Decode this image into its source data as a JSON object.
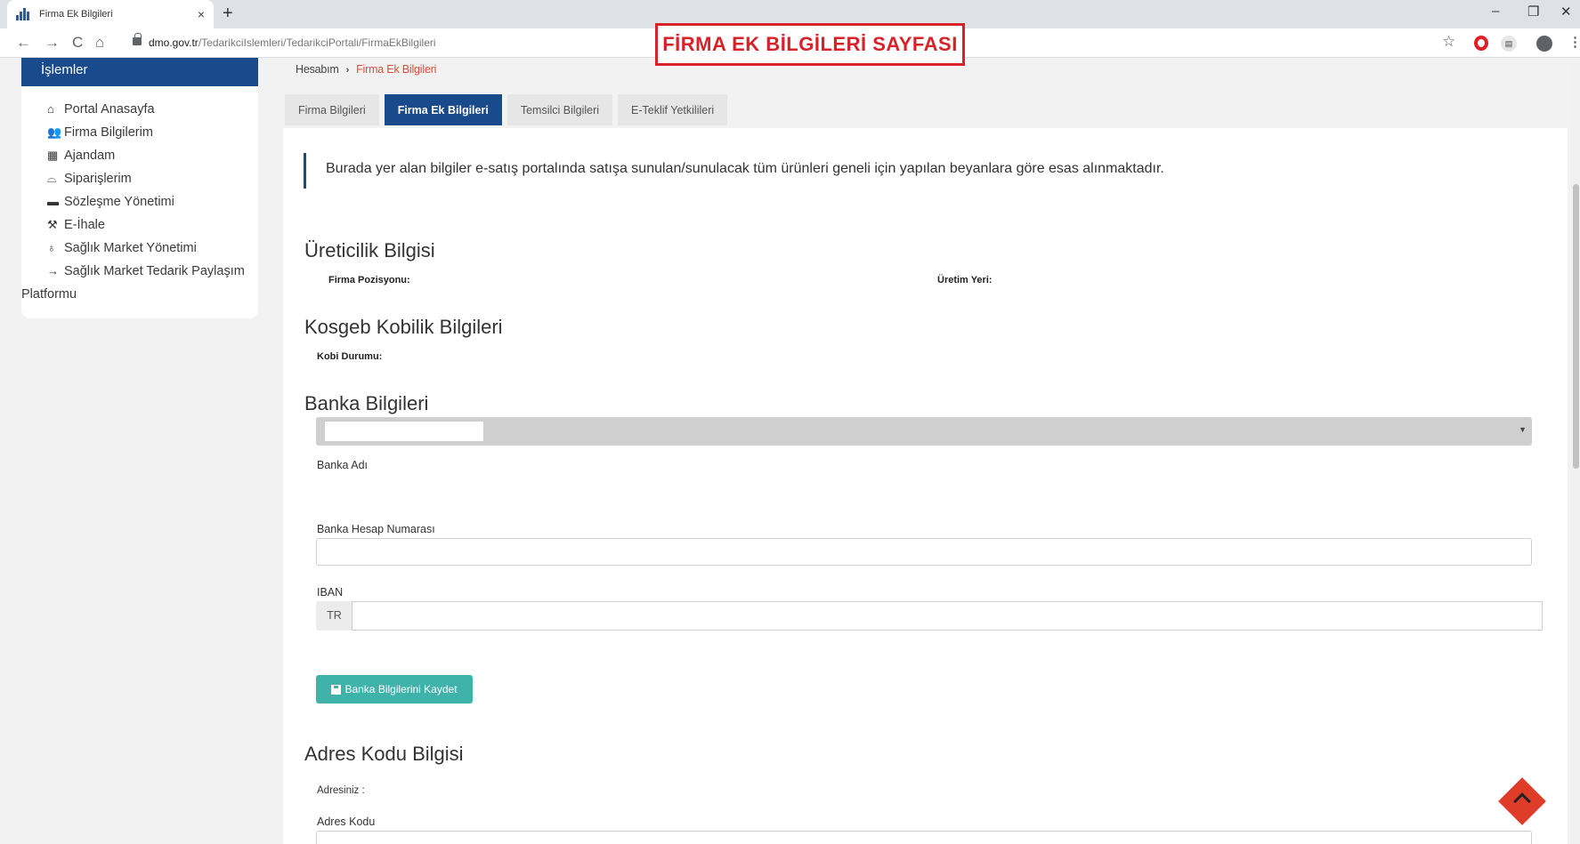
{
  "browser": {
    "tab_title": "Firma Ek Bilgileri",
    "close_glyph": "×",
    "newtab_glyph": "+",
    "minimize_glyph": "–",
    "restore_glyph": "❐",
    "winclose_glyph": "✕",
    "back_glyph": "←",
    "forward_glyph": "→",
    "reload_glyph": "C",
    "home_glyph": "⌂",
    "url_domain": "dmo.gov.tr",
    "url_path": "/TedarikciIslemleri/TedarikciPortali/FirmaEkBilgileri",
    "star_glyph": "☆",
    "menu_glyph": "⋮"
  },
  "annotation": "FİRMA EK BİLGİLERİ SAYFASI",
  "sidebar": {
    "title": "İşlemler",
    "items": [
      {
        "icon": "home-icon",
        "glyph": "⌂",
        "label": "Portal Anasayfa"
      },
      {
        "icon": "users-icon",
        "glyph": "👥",
        "label": "Firma Bilgilerim"
      },
      {
        "icon": "calendar-icon",
        "glyph": "▦",
        "label": "Ajandam"
      },
      {
        "icon": "basket-icon",
        "glyph": "⌓",
        "label": "Siparişlerim"
      },
      {
        "icon": "briefcase-icon",
        "glyph": "▬",
        "label": "Sözleşme Yönetimi"
      },
      {
        "icon": "gavel-icon",
        "glyph": "⚒",
        "label": "E-İhale"
      },
      {
        "icon": "stethoscope-icon",
        "glyph": "♁",
        "label": "Sağlık Market Yönetimi"
      },
      {
        "icon": "arrow-right-icon",
        "glyph": "→",
        "label": "Sağlık Market Tedarik Paylaşım",
        "label2": "Platformu"
      }
    ]
  },
  "breadcrumb": {
    "root": "Hesabım",
    "sep": "›",
    "current": "Firma Ek Bilgileri"
  },
  "tabs": [
    {
      "label": "Firma Bilgileri",
      "active": false
    },
    {
      "label": "Firma Ek Bilgileri",
      "active": true
    },
    {
      "label": "Temsilci Bilgileri",
      "active": false
    },
    {
      "label": "E-Teklif Yetkilileri",
      "active": false
    }
  ],
  "notice": "Burada yer alan bilgiler e-satış portalında satışa sunulan/sunulacak tüm ürünleri geneli için yapılan beyanlara göre esas alınmaktadır.",
  "ureticilik": {
    "title": "Üreticilik Bilgisi",
    "firma_pozisyonu": "Firma Pozisyonu:",
    "uretim_yeri": "Üretim Yeri:"
  },
  "kosgeb": {
    "title": "Kosgeb Kobilik Bilgileri",
    "kobi_durumu": "Kobi Durumu:"
  },
  "banka": {
    "title": "Banka Bilgileri",
    "banka_adi_label": "Banka Adı",
    "banka_adi_value": "",
    "hesap_no_label": "Banka Hesap Numarası",
    "hesap_no_value": "",
    "iban_label": "IBAN",
    "iban_prefix": "TR",
    "iban_value": "",
    "save_label": "Banka Bilgilerini Kaydet"
  },
  "adres": {
    "title": "Adres Kodu Bilgisi",
    "adresiniz": "Adresiniz :",
    "adres_kodu_label": "Adres Kodu",
    "adres_kodu_value": ""
  },
  "colors": {
    "primary": "#184a8c",
    "accent": "#e04a3a",
    "save_button": "#3fb2aa",
    "annotation": "#d8222a"
  }
}
